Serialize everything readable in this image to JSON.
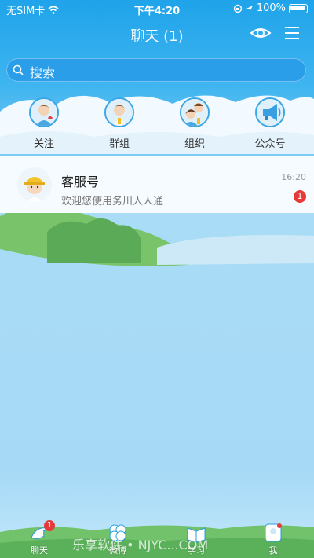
{
  "status": {
    "carrier": "无SIM卡",
    "time": "下午4:20",
    "battery": "100%"
  },
  "nav": {
    "title": "聊天 (1)"
  },
  "search": {
    "placeholder": "搜索"
  },
  "categories": [
    {
      "label": "关注",
      "icon": "follow-avatar-icon"
    },
    {
      "label": "群组",
      "icon": "group-avatar-icon"
    },
    {
      "label": "组织",
      "icon": "organization-avatar-icon"
    },
    {
      "label": "公众号",
      "icon": "megaphone-icon"
    }
  ],
  "chat": {
    "name": "客服号",
    "message": "欢迎您使用务川人人通",
    "time": "16:20",
    "unread": "1"
  },
  "tabs": [
    {
      "label": "聊天",
      "badge": "1"
    },
    {
      "label": "微博"
    },
    {
      "label": "学习"
    },
    {
      "label": "我"
    }
  ],
  "watermark": "乐享软件 • NJYC...COM",
  "colors": {
    "accent": "#1fa3ea",
    "badge": "#e63939",
    "sky": "#a6d9f6"
  }
}
